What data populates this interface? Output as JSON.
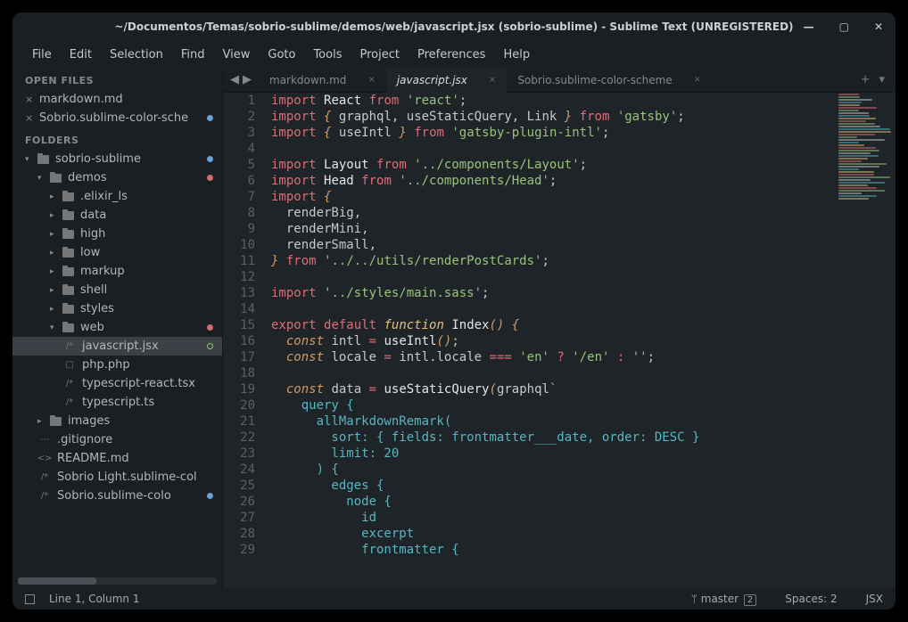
{
  "title": "~/Documentos/Temas/sobrio-sublime/demos/web/javascript.jsx (sobrio-sublime) - Sublime Text (UNREGISTERED)",
  "menu": [
    "File",
    "Edit",
    "Selection",
    "Find",
    "View",
    "Goto",
    "Tools",
    "Project",
    "Preferences",
    "Help"
  ],
  "sidebar": {
    "open_files_label": "Open Files",
    "open_files": [
      {
        "name": "markdown.md",
        "dot": null
      },
      {
        "name": "Sobrio.sublime-color-sche",
        "dot": "#6aa0d8"
      }
    ],
    "folders_label": "Folders",
    "tree": [
      {
        "t": "folder",
        "name": "sobrio-sublime",
        "pad": 0,
        "chev": "▾",
        "dot": "#6aa0d8"
      },
      {
        "t": "folder",
        "name": "demos",
        "pad": 1,
        "chev": "▾",
        "dot": "#d46a6a"
      },
      {
        "t": "folder",
        "name": ".elixir_ls",
        "pad": 2,
        "chev": "▸"
      },
      {
        "t": "folder",
        "name": "data",
        "pad": 2,
        "chev": "▸"
      },
      {
        "t": "folder",
        "name": "high",
        "pad": 2,
        "chev": "▸"
      },
      {
        "t": "folder",
        "name": "low",
        "pad": 2,
        "chev": "▸"
      },
      {
        "t": "folder",
        "name": "markup",
        "pad": 2,
        "chev": "▸"
      },
      {
        "t": "folder",
        "name": "shell",
        "pad": 2,
        "chev": "▸"
      },
      {
        "t": "folder",
        "name": "styles",
        "pad": 2,
        "chev": "▸"
      },
      {
        "t": "folder",
        "name": "web",
        "pad": 2,
        "chev": "▾",
        "dot": "#d46a6a"
      },
      {
        "t": "file",
        "name": "javascript.jsx",
        "pad": 3,
        "fi": "/*",
        "sel": true,
        "dot": "#98c379",
        "hollow": true
      },
      {
        "t": "file",
        "name": "php.php",
        "pad": 3,
        "fi": "□"
      },
      {
        "t": "file",
        "name": "typescript-react.tsx",
        "pad": 3,
        "fi": "/*"
      },
      {
        "t": "file",
        "name": "typescript.ts",
        "pad": 3,
        "fi": "/*"
      },
      {
        "t": "folder",
        "name": "images",
        "pad": 1,
        "chev": "▸"
      },
      {
        "t": "file",
        "name": ".gitignore",
        "pad": 1,
        "fi": "⋯"
      },
      {
        "t": "file",
        "name": "README.md",
        "pad": 1,
        "fi": "<>"
      },
      {
        "t": "file",
        "name": "Sobrio Light.sublime-col",
        "pad": 1,
        "fi": "/*"
      },
      {
        "t": "file",
        "name": "Sobrio.sublime-colo",
        "pad": 1,
        "fi": "/*",
        "dot": "#6aa0d8"
      }
    ]
  },
  "tabs": [
    {
      "label": "markdown.md",
      "active": false
    },
    {
      "label": "javascript.jsx",
      "active": true
    },
    {
      "label": "Sobrio.sublime-color-scheme",
      "active": false
    }
  ],
  "code": {
    "lines": [
      [
        [
          "k1",
          "import"
        ],
        [
          "p1",
          " "
        ],
        [
          "nm",
          "React"
        ],
        [
          "p1",
          " "
        ],
        [
          "k1",
          "from"
        ],
        [
          "p1",
          " "
        ],
        [
          "s1",
          "'react'"
        ],
        [
          "p1",
          ";"
        ]
      ],
      [
        [
          "k1",
          "import"
        ],
        [
          "p1",
          " "
        ],
        [
          "k3",
          "{"
        ],
        [
          "p1",
          " "
        ],
        [
          "n2",
          "graphql"
        ],
        [
          "p1",
          ", "
        ],
        [
          "n2",
          "useStaticQuery"
        ],
        [
          "p1",
          ", "
        ],
        [
          "n2",
          "Link"
        ],
        [
          "p1",
          " "
        ],
        [
          "k3",
          "}"
        ],
        [
          "p1",
          " "
        ],
        [
          "k1",
          "from"
        ],
        [
          "p1",
          " "
        ],
        [
          "s1",
          "'gatsby'"
        ],
        [
          "p1",
          ";"
        ]
      ],
      [
        [
          "k1",
          "import"
        ],
        [
          "p1",
          " "
        ],
        [
          "k3",
          "{"
        ],
        [
          "p1",
          " "
        ],
        [
          "n2",
          "useIntl"
        ],
        [
          "p1",
          " "
        ],
        [
          "k3",
          "}"
        ],
        [
          "p1",
          " "
        ],
        [
          "k1",
          "from"
        ],
        [
          "p1",
          " "
        ],
        [
          "s1",
          "'gatsby-plugin-intl'"
        ],
        [
          "p1",
          ";"
        ]
      ],
      [],
      [
        [
          "k1",
          "import"
        ],
        [
          "p1",
          " "
        ],
        [
          "nm",
          "Layout"
        ],
        [
          "p1",
          " "
        ],
        [
          "k1",
          "from"
        ],
        [
          "p1",
          " "
        ],
        [
          "s1",
          "'../components/Layout'"
        ],
        [
          "p1",
          ";"
        ]
      ],
      [
        [
          "k1",
          "import"
        ],
        [
          "p1",
          " "
        ],
        [
          "nm",
          "Head"
        ],
        [
          "p1",
          " "
        ],
        [
          "k1",
          "from"
        ],
        [
          "p1",
          " "
        ],
        [
          "s1",
          "'../components/Head'"
        ],
        [
          "p1",
          ";"
        ]
      ],
      [
        [
          "k1",
          "import"
        ],
        [
          "p1",
          " "
        ],
        [
          "k3",
          "{"
        ]
      ],
      [
        [
          "p1",
          "  "
        ],
        [
          "n2",
          "renderBig"
        ],
        [
          "p1",
          ","
        ]
      ],
      [
        [
          "p1",
          "  "
        ],
        [
          "n2",
          "renderMini"
        ],
        [
          "p1",
          ","
        ]
      ],
      [
        [
          "p1",
          "  "
        ],
        [
          "n2",
          "renderSmall"
        ],
        [
          "p1",
          ","
        ]
      ],
      [
        [
          "k3",
          "}"
        ],
        [
          "p1",
          " "
        ],
        [
          "k1",
          "from"
        ],
        [
          "p1",
          " "
        ],
        [
          "s1",
          "'../../utils/renderPostCards'"
        ],
        [
          "p1",
          ";"
        ]
      ],
      [],
      [
        [
          "k1",
          "import"
        ],
        [
          "p1",
          " "
        ],
        [
          "s1",
          "'../styles/main.sass'"
        ],
        [
          "p1",
          ";"
        ]
      ],
      [],
      [
        [
          "k1",
          "export"
        ],
        [
          "p1",
          " "
        ],
        [
          "k1",
          "default"
        ],
        [
          "p1",
          " "
        ],
        [
          "fn",
          "function"
        ],
        [
          "p1",
          " "
        ],
        [
          "nm",
          "Index"
        ],
        [
          "k3",
          "()"
        ],
        [
          "p1",
          " "
        ],
        [
          "k3",
          "{"
        ]
      ],
      [
        [
          "p1",
          "  "
        ],
        [
          "k3",
          "const"
        ],
        [
          "p1",
          " "
        ],
        [
          "n2",
          "intl"
        ],
        [
          "p1",
          " "
        ],
        [
          "op",
          "="
        ],
        [
          "p1",
          " "
        ],
        [
          "nm",
          "useIntl"
        ],
        [
          "k3",
          "()"
        ],
        [
          "p1",
          ";"
        ]
      ],
      [
        [
          "p1",
          "  "
        ],
        [
          "k3",
          "const"
        ],
        [
          "p1",
          " "
        ],
        [
          "n2",
          "locale"
        ],
        [
          "p1",
          " "
        ],
        [
          "op",
          "="
        ],
        [
          "p1",
          " "
        ],
        [
          "n2",
          "intl"
        ],
        [
          "p1",
          "."
        ],
        [
          "n2",
          "locale"
        ],
        [
          "p1",
          " "
        ],
        [
          "op",
          "==="
        ],
        [
          "p1",
          " "
        ],
        [
          "s1",
          "'en'"
        ],
        [
          "p1",
          " "
        ],
        [
          "op",
          "?"
        ],
        [
          "p1",
          " "
        ],
        [
          "s1",
          "'/en'"
        ],
        [
          "p1",
          " "
        ],
        [
          "op",
          ":"
        ],
        [
          "p1",
          " "
        ],
        [
          "s1",
          "''"
        ],
        [
          "p1",
          ";"
        ]
      ],
      [],
      [
        [
          "p1",
          "  "
        ],
        [
          "k3",
          "const"
        ],
        [
          "p1",
          " "
        ],
        [
          "n2",
          "data"
        ],
        [
          "p1",
          " "
        ],
        [
          "op",
          "="
        ],
        [
          "p1",
          " "
        ],
        [
          "nm",
          "useStaticQuery"
        ],
        [
          "k3",
          "("
        ],
        [
          "n2",
          "graphql"
        ],
        [
          "s1",
          "`"
        ]
      ],
      [
        [
          "gq",
          "    query {"
        ]
      ],
      [
        [
          "gq",
          "      allMarkdownRemark("
        ]
      ],
      [
        [
          "gq",
          "        sort: { fields: frontmatter___date, order: DESC }"
        ]
      ],
      [
        [
          "gq",
          "        limit: 20"
        ]
      ],
      [
        [
          "gq",
          "      ) {"
        ]
      ],
      [
        [
          "gq",
          "        edges {"
        ]
      ],
      [
        [
          "gq",
          "          node {"
        ]
      ],
      [
        [
          "gq",
          "            id"
        ]
      ],
      [
        [
          "gq",
          "            excerpt"
        ]
      ],
      [
        [
          "gq",
          "            frontmatter {"
        ]
      ]
    ]
  },
  "status": {
    "pos": "Line 1, Column 1",
    "branch": "master",
    "branch_count": "2",
    "spaces": "Spaces: 2",
    "lang": "JSX"
  }
}
